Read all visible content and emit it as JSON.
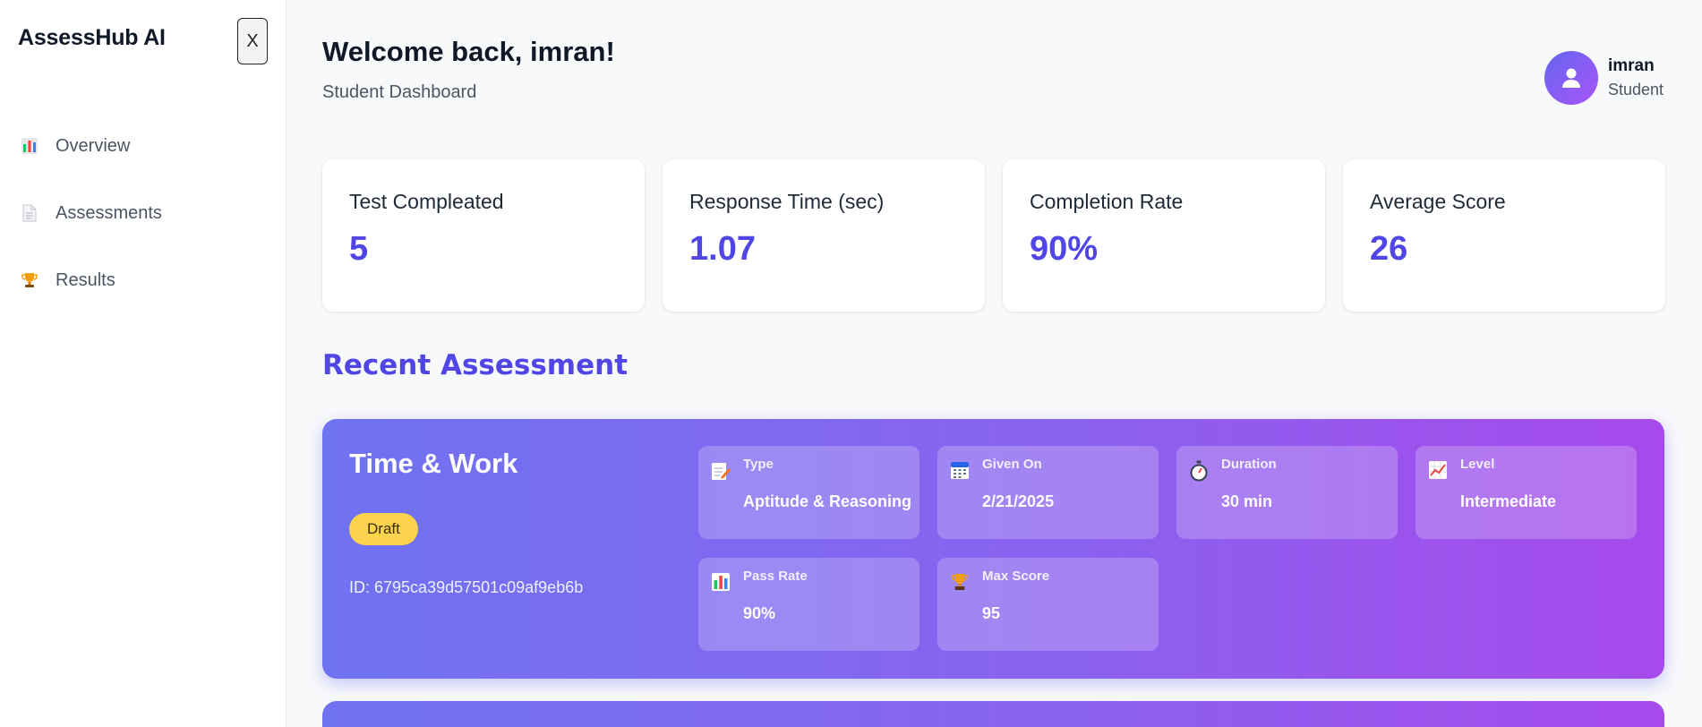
{
  "sidebar": {
    "brand": "AssessHub AI",
    "close_label": "X",
    "items": [
      {
        "label": "Overview",
        "icon": "bar-chart-icon"
      },
      {
        "label": "Assessments",
        "icon": "document-icon"
      },
      {
        "label": "Results",
        "icon": "trophy-icon"
      }
    ]
  },
  "header": {
    "welcome": "Welcome back, imran!",
    "subtitle": "Student Dashboard",
    "user_name": "imran",
    "user_role": "Student"
  },
  "stats": [
    {
      "label": "Test Compleated",
      "value": "5"
    },
    {
      "label": "Response Time (sec)",
      "value": "1.07"
    },
    {
      "label": "Completion Rate",
      "value": "90%"
    },
    {
      "label": "Average Score",
      "value": "26"
    }
  ],
  "recent": {
    "section_title": "Recent Assessment",
    "card": {
      "title": "Time & Work",
      "status": "Draft",
      "id_text": "ID: 6795ca39d57501c09af9eb6b",
      "details": [
        {
          "label": "Type",
          "value": "Aptitude & Reasoning",
          "icon": "memo-icon"
        },
        {
          "label": "Given On",
          "value": "2/21/2025",
          "icon": "calendar-icon"
        },
        {
          "label": "Duration",
          "value": "30 min",
          "icon": "stopwatch-icon"
        },
        {
          "label": "Level",
          "value": "Intermediate",
          "icon": "trend-chart-icon"
        },
        {
          "label": "Pass Rate",
          "value": "90%",
          "icon": "bar-chart-icon"
        },
        {
          "label": "Max Score",
          "value": "95",
          "icon": "trophy-icon"
        }
      ]
    }
  },
  "colors": {
    "accent": "#4f46e5",
    "badge": "#fcd34d",
    "card_gradient_start": "#6f73f1",
    "card_gradient_end": "#a64aeb"
  }
}
